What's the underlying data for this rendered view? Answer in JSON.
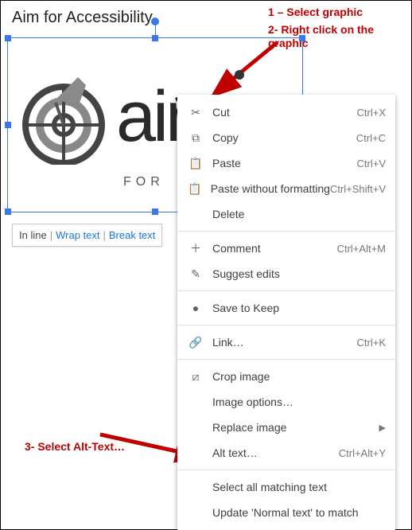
{
  "page": {
    "title": "Aim for Accessibility"
  },
  "annotations": {
    "step1": "1 – Select graphic",
    "step2": "2- Right click on the graphic",
    "step3": "3- Select Alt-Text…"
  },
  "graphic": {
    "word": "aim",
    "subtitle": "FOR"
  },
  "wrap_bar": {
    "inline": "In line",
    "wrap": "Wrap text",
    "break": "Break text"
  },
  "menu": {
    "cut": {
      "label": "Cut",
      "shortcut": "Ctrl+X"
    },
    "copy": {
      "label": "Copy",
      "shortcut": "Ctrl+C"
    },
    "paste": {
      "label": "Paste",
      "shortcut": "Ctrl+V"
    },
    "paste_plain": {
      "label": "Paste without formatting",
      "shortcut": "Ctrl+Shift+V"
    },
    "delete": {
      "label": "Delete",
      "shortcut": ""
    },
    "comment": {
      "label": "Comment",
      "shortcut": "Ctrl+Alt+M"
    },
    "suggest": {
      "label": "Suggest edits",
      "shortcut": ""
    },
    "keep": {
      "label": "Save to Keep",
      "shortcut": ""
    },
    "link": {
      "label": "Link…",
      "shortcut": "Ctrl+K"
    },
    "crop": {
      "label": "Crop image",
      "shortcut": ""
    },
    "image_options": {
      "label": "Image options…",
      "shortcut": ""
    },
    "replace": {
      "label": "Replace image",
      "shortcut": ""
    },
    "alt": {
      "label": "Alt text…",
      "shortcut": "Ctrl+Alt+Y"
    },
    "select_match": {
      "label": "Select all matching text",
      "shortcut": ""
    },
    "update_style": {
      "label": "Update 'Normal text' to match",
      "shortcut": ""
    }
  }
}
